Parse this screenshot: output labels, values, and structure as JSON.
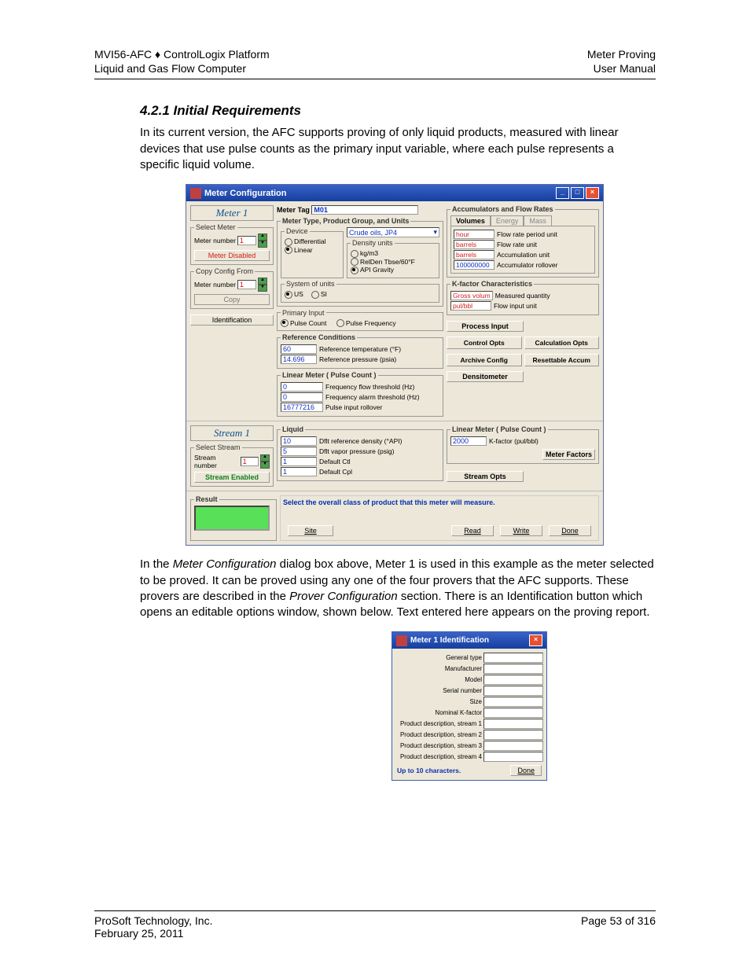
{
  "header": {
    "left1": "MVI56-AFC ♦ ControlLogix Platform",
    "left2": "Liquid and Gas Flow Computer",
    "right1": "Meter Proving",
    "right2": "User Manual"
  },
  "section_title": "4.2.1   Initial Requirements",
  "para1": "In its current version, the AFC supports proving of only liquid products, measured with linear devices that use pulse counts as the primary input variable, where each pulse represents a specific liquid volume.",
  "para2_a": "In the ",
  "para2_b": "Meter Configuration",
  "para2_c": " dialog box above,  Meter 1 is used in this example as the meter selected to be proved. It can be proved using any one of the four provers that the AFC supports. These provers are described in the ",
  "para2_d": "Prover Configuration",
  "para2_e": " section. There is an Identification button which opens an editable options window, shown below. Text entered here appears on the proving report.",
  "dlg1": {
    "title": "Meter Configuration",
    "meter_title": "Meter 1",
    "select_meter": "Select Meter",
    "meter_number_label": "Meter number",
    "meter_number": "1",
    "meter_disabled": "Meter Disabled",
    "copy_from": "Copy Config From",
    "copy_number": "1",
    "copy": "Copy",
    "identification": "Identification",
    "meter_tag_label": "Meter Tag",
    "meter_tag": "M01",
    "type_group_units": "Meter Type, Product Group, and Units",
    "device": "Device",
    "differential": "Differential",
    "linear": "Linear",
    "product_sel": "Crude oils, JP4",
    "density_units": "Density units",
    "kgm3": "kg/m3",
    "relden": "RelDen Tbse/60°F",
    "api_gravity": "API Gravity",
    "system_units": "System of units",
    "us": "US",
    "si": "SI",
    "primary_input": "Primary Input",
    "pulse_count": "Pulse Count",
    "pulse_freq": "Pulse Frequency",
    "ref_cond": "Reference Conditions",
    "ref_temp_val": "60",
    "ref_temp_lbl": "Reference temperature (°F)",
    "ref_pres_val": "14.696",
    "ref_pres_lbl": "Reference pressure (psia)",
    "lmpc": "Linear Meter ( Pulse Count )",
    "freq_flow_val": "0",
    "freq_flow_lbl": "Frequency flow threshold (Hz)",
    "freq_alarm_val": "0",
    "freq_alarm_lbl": "Frequency alarm threshold (Hz)",
    "pulse_roll_val": "16777216",
    "pulse_roll_lbl": "Pulse input rollover",
    "accum_fr": "Accumulators and Flow Rates",
    "tab_volumes": "Volumes",
    "tab_energy": "Energy",
    "tab_mass": "Mass",
    "hour": "hour",
    "hour_lbl": "Flow rate period unit",
    "barrels1": "barrels",
    "barrels1_lbl": "Flow rate unit",
    "barrels2": "barrels",
    "barrels2_lbl": "Accumulation unit",
    "rollover": "100000000",
    "rollover_lbl": "Accumulator rollover",
    "kfactor": "K-factor Characteristics",
    "gross_vol": "Gross volum",
    "gross_vol_lbl": "Measured quantity",
    "pul_bbl": "pul/bbl",
    "pul_bbl_lbl": "Flow input unit",
    "process_input": "Process Input",
    "control_opts": "Control Opts",
    "calc_opts": "Calculation Opts",
    "archive_config": "Archive Config",
    "reset_accum": "Resettable Accum",
    "densitometer": "Densitometer",
    "stream_title": "Stream 1",
    "select_stream": "Select Stream",
    "stream_number_label": "Stream number",
    "stream_number": "1",
    "stream_enabled": "Stream Enabled",
    "liquid": "Liquid",
    "liq1_v": "10",
    "liq1_l": "Dflt reference density (°API)",
    "liq2_v": "5",
    "liq2_l": "Dflt vapor pressure (psig)",
    "liq3_v": "1",
    "liq3_l": "Default Ctl",
    "liq4_v": "1",
    "liq4_l": "Default Cpl",
    "lmpc2": "Linear Meter ( Pulse Count )",
    "kf_val": "2000",
    "kf_lbl": "K-factor (pul/bbl)",
    "meter_factors": "Meter Factors",
    "stream_opts": "Stream Opts",
    "result": "Result",
    "result_msg": "Select the overall class of product that this meter will measure.",
    "site": "Site",
    "read": "Read",
    "write": "Write",
    "done": "Done"
  },
  "dlg2": {
    "title": "Meter 1 Identification",
    "rows": [
      "General type",
      "Manufacturer",
      "Model",
      "Serial number",
      "Size",
      "Nominal K-factor",
      "Product description, stream 1",
      "Product description, stream 2",
      "Product description, stream 3",
      "Product description, stream 4"
    ],
    "hint": "Up to 10 characters.",
    "done": "Done"
  },
  "footer": {
    "company": "ProSoft Technology, Inc.",
    "date": "February 25, 2011",
    "page": "Page 53 of 316"
  }
}
